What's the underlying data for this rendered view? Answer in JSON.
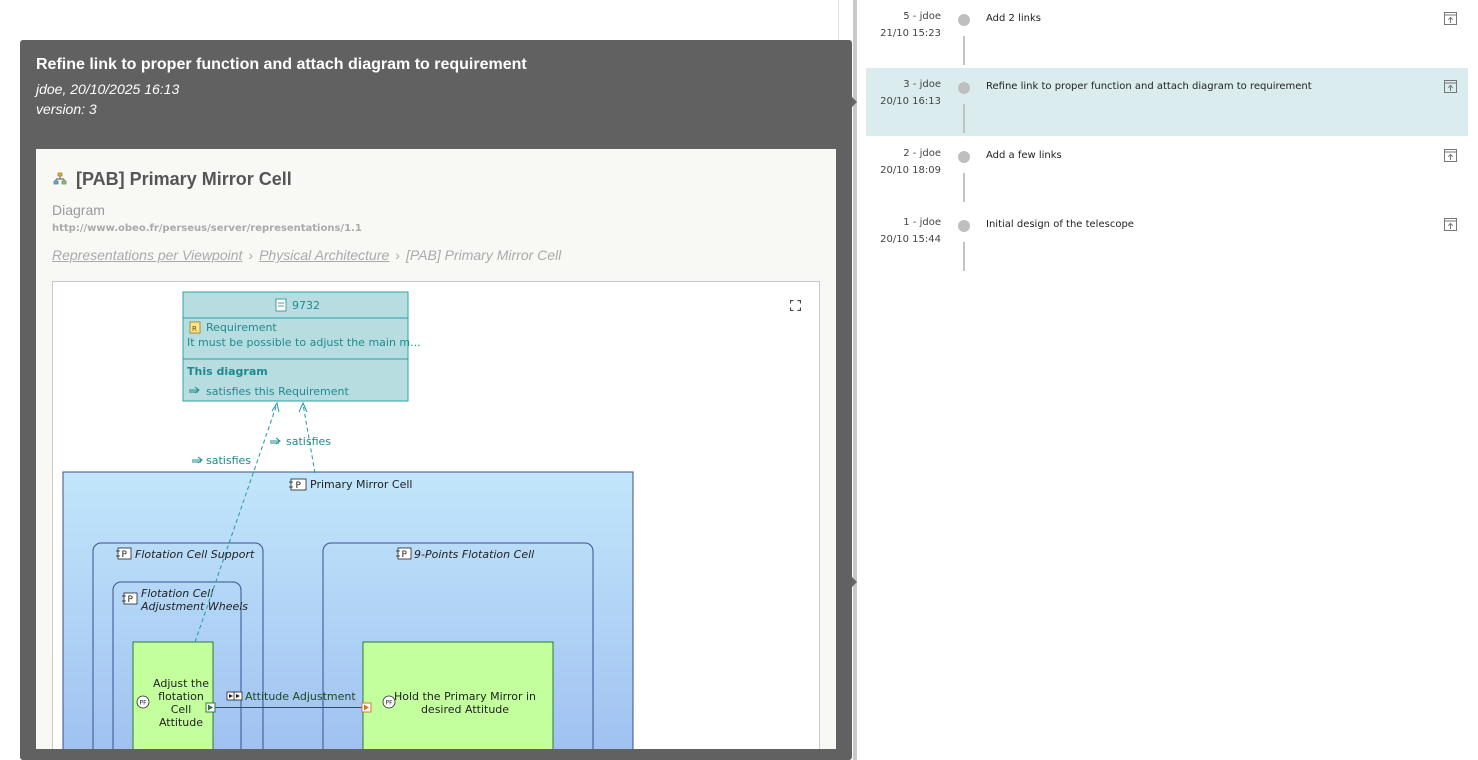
{
  "history": {
    "versions": [
      {
        "number_user": "5 - jdoe",
        "datetime": "21/10 15:23",
        "title": "Add 2 links",
        "selected": false
      },
      {
        "number_user": "3 - jdoe",
        "datetime": "20/10 16:13",
        "title": "Refine link to proper function and attach diagram to requirement",
        "selected": true
      },
      {
        "number_user": "2 - jdoe",
        "datetime": "20/10 18:09",
        "title": "Add a few links",
        "selected": false
      },
      {
        "number_user": "1 - jdoe",
        "datetime": "20/10 15:44",
        "title": "Initial design of the telescope",
        "selected": false
      }
    ]
  },
  "popup": {
    "title": "Refine link to proper function and attach diagram to requirement",
    "author_date": "jdoe, 20/10/2025 16:13",
    "version": "version: 3"
  },
  "card": {
    "title": "[PAB] Primary Mirror Cell",
    "kind": "Diagram",
    "url": "http://www.obeo.fr/perseus/server/representations/1.1",
    "breadcrumb": [
      "Representations per Viewpoint",
      "Physical Architecture",
      "[PAB] Primary Mirror Cell"
    ]
  },
  "diagram": {
    "requirement": {
      "id": "9732",
      "type": "Requirement",
      "text": "It must be possible to adjust the main m...",
      "section_title": "This diagram",
      "section_link": "satisfies this Requirement"
    },
    "link_labels": [
      "satisfies",
      "satisfies"
    ],
    "containers": {
      "outer": "Primary Mirror Cell",
      "support": "Flotation Cell Support",
      "wheels_line1": "Flotation Cell",
      "wheels_line2": "Adjustment Wheels",
      "nine_points": "9-Points Flotation Cell"
    },
    "functions": {
      "adjust": [
        "Adjust the",
        "flotation",
        "Cell",
        "Attitude"
      ],
      "hold": [
        "Hold the Primary Mirror in",
        "desired Attitude"
      ]
    },
    "exchange": "Attitude Adjustment",
    "icon_badges": {
      "physical": "P",
      "function": "PF"
    }
  },
  "colors": {
    "popup_bg": "#616161",
    "selected_row": "#dbecef",
    "requirement_fill": "#b7dde0",
    "requirement_text": "#1e8a8f",
    "container_top": "#c2e6fb",
    "container_bottom": "#9dbff0",
    "function_fill": "#c4ff9e"
  }
}
